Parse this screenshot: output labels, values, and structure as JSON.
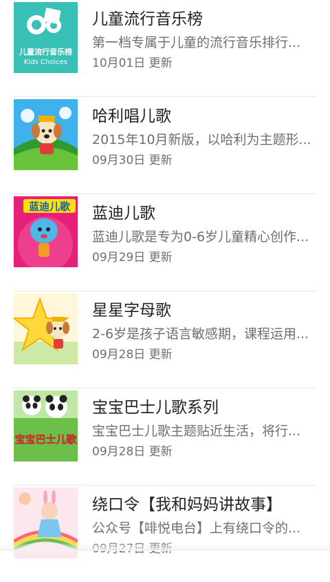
{
  "items": [
    {
      "title": "儿童流行音乐榜",
      "desc": "第一档专属于儿童的流行音乐排行...",
      "date": "10月01日 更新",
      "cover_text_cn": "儿童流行音乐榜",
      "cover_text_en": "Kids Choices"
    },
    {
      "title": "哈利唱儿歌",
      "desc": "2015年10月新版，以哈利为主题形...",
      "date": "09月30日 更新"
    },
    {
      "title": "蓝迪儿歌",
      "desc": "蓝迪儿歌是专为0-6岁儿童精心创作...",
      "date": "09月29日 更新",
      "cover_text_cn": "蓝迪儿歌"
    },
    {
      "title": "星星字母歌",
      "desc": "2-6岁是孩子语言敏感期，课程运用...",
      "date": "09月28日 更新"
    },
    {
      "title": "宝宝巴士儿歌系列",
      "desc": "宝宝巴士儿歌主题贴近生活，将行...",
      "date": "09月28日 更新",
      "cover_text_cn": "宝宝巴士儿歌"
    },
    {
      "title": "绕口令【我和妈妈讲故事】",
      "desc": "公众号【啡悦电台】上有绕口令的...",
      "date": "09月27日 更新"
    }
  ],
  "colors": {
    "divider": "#e6e6e6",
    "title": "#222222",
    "meta": "#6e6e6e"
  }
}
